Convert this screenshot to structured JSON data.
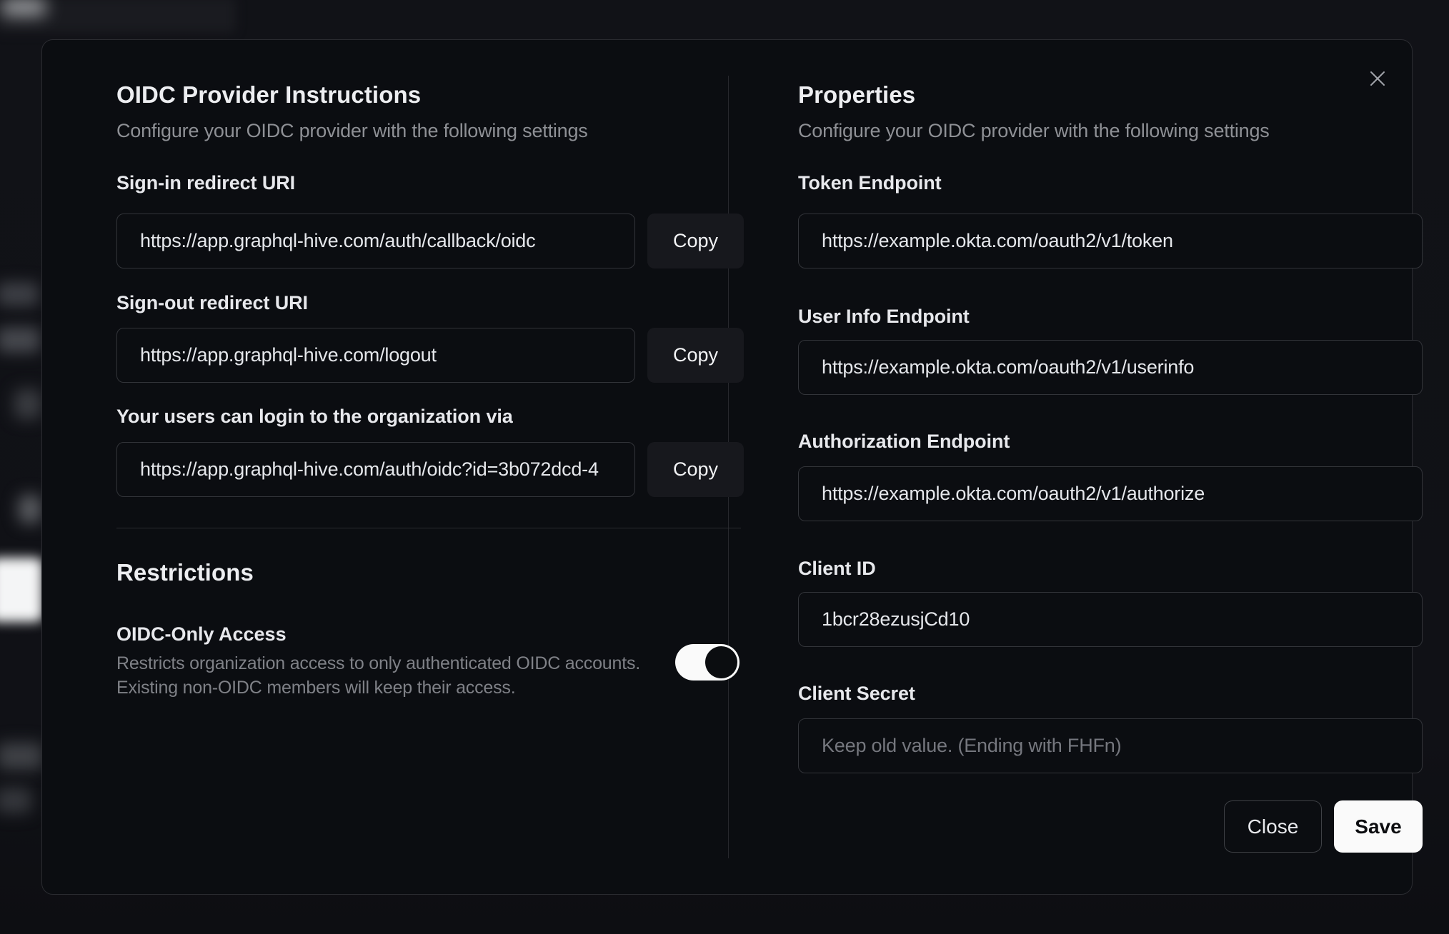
{
  "colors": {
    "modal_background": "#0b0d11",
    "backdrop": "#111217",
    "input_border": "#323439",
    "copy_button_background": "#17181d",
    "toggle_on_track": "#fafafa",
    "save_button_background": "#fafafa",
    "save_button_text": "#0c0d10",
    "heading_text": "#edeef1",
    "muted_text": "#8e9095"
  },
  "modal": {
    "instructions": {
      "title": "OIDC Provider Instructions",
      "subtitle": "Configure your OIDC provider with the following settings",
      "signin": {
        "label": "Sign-in redirect URI",
        "value": "https://app.graphql-hive.com/auth/callback/oidc",
        "copy_label": "Copy"
      },
      "signout": {
        "label": "Sign-out redirect URI",
        "value": "https://app.graphql-hive.com/logout",
        "copy_label": "Copy"
      },
      "login_via": {
        "label": "Your users can login to the organization via",
        "value": "https://app.graphql-hive.com/auth/oidc?id=3b072dcd-4",
        "copy_label": "Copy"
      }
    },
    "restrictions": {
      "title": "Restrictions",
      "oidc_only": {
        "label": "OIDC-Only Access",
        "description_line1": "Restricts organization access to only authenticated OIDC accounts.",
        "description_line2": "Existing non-OIDC members will keep their access.",
        "enabled": true
      }
    },
    "properties": {
      "title": "Properties",
      "subtitle": "Configure your OIDC provider with the following settings",
      "token_endpoint": {
        "label": "Token Endpoint",
        "value": "https://example.okta.com/oauth2/v1/token"
      },
      "userinfo_endpoint": {
        "label": "User Info Endpoint",
        "value": "https://example.okta.com/oauth2/v1/userinfo"
      },
      "authorization_endpoint": {
        "label": "Authorization Endpoint",
        "value": "https://example.okta.com/oauth2/v1/authorize"
      },
      "client_id": {
        "label": "Client ID",
        "value": "1bcr28ezusjCd10"
      },
      "client_secret": {
        "label": "Client Secret",
        "placeholder": "Keep old value. (Ending with FHFn)"
      }
    },
    "footer": {
      "close_label": "Close",
      "save_label": "Save"
    }
  }
}
